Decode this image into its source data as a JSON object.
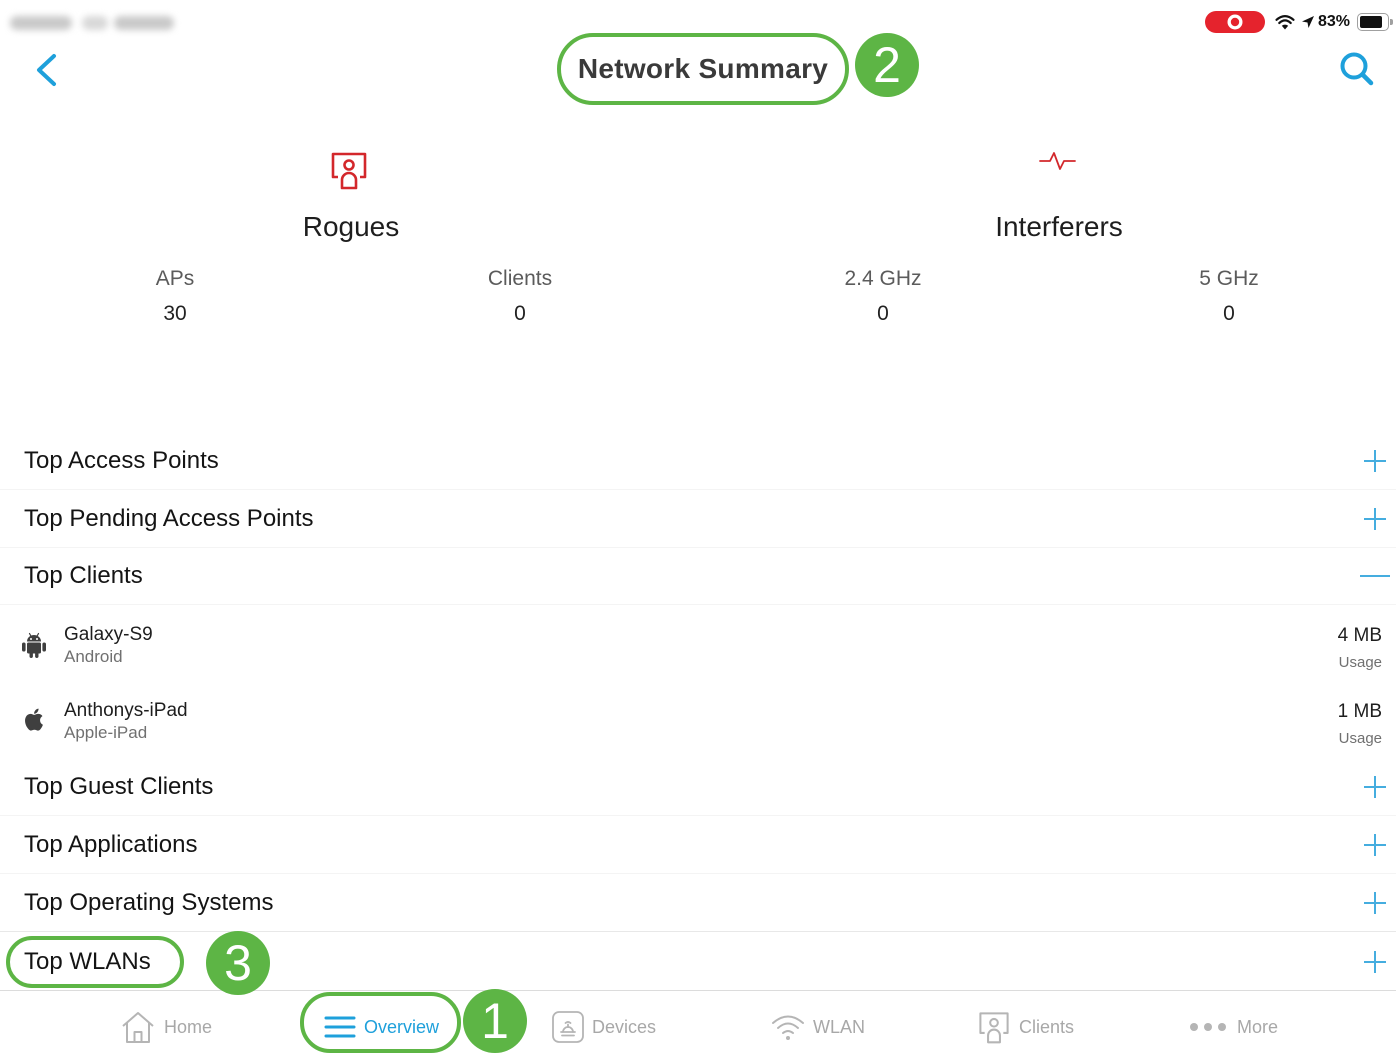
{
  "status_bar": {
    "recording_indicator_icon": "screen-recording-icon",
    "wifi_icon": "wifi-signal-icon",
    "location_icon": "location-arrow-icon",
    "battery_icon": "battery-icon",
    "battery_text": "83%",
    "battery_level": 83
  },
  "header": {
    "back_icon": "chevron-left-icon",
    "title": "Network Summary",
    "search_icon": "search-icon"
  },
  "summary": {
    "rogues": {
      "icon": "rogue-icon",
      "title": "Rogues",
      "stats": [
        {
          "label": "APs",
          "value": 30
        },
        {
          "label": "Clients",
          "value": 0
        }
      ]
    },
    "interferers": {
      "icon": "pulse-icon",
      "title": "Interferers",
      "stats": [
        {
          "label": "2.4 GHz",
          "value": 0
        },
        {
          "label": "5 GHz",
          "value": 0
        }
      ]
    }
  },
  "sections": [
    {
      "label": "Top Access Points",
      "expanded": false,
      "toggle_icon": "plus-icon"
    },
    {
      "label": "Top Pending Access Points",
      "expanded": false,
      "toggle_icon": "plus-icon"
    },
    {
      "label": "Top Clients",
      "expanded": true,
      "toggle_icon": "minus-icon",
      "items": [
        {
          "icon": "android-icon",
          "name": "Galaxy-S9",
          "type": "Android",
          "usage": "4 MB",
          "usage_label": "Usage"
        },
        {
          "icon": "apple-icon",
          "name": "Anthonys-iPad",
          "type": "Apple-iPad",
          "usage": "1 MB",
          "usage_label": "Usage"
        }
      ]
    },
    {
      "label": "Top Guest Clients",
      "expanded": false,
      "toggle_icon": "plus-icon"
    },
    {
      "label": "Top Applications",
      "expanded": false,
      "toggle_icon": "plus-icon"
    },
    {
      "label": "Top Operating Systems",
      "expanded": false,
      "toggle_icon": "plus-icon"
    },
    {
      "label": "Top WLANs",
      "expanded": false,
      "toggle_icon": "plus-icon"
    }
  ],
  "tab_bar": {
    "tabs": [
      {
        "label": "Home",
        "icon": "home-icon",
        "active": false
      },
      {
        "label": "Overview",
        "icon": "menu-icon",
        "active": true
      },
      {
        "label": "Devices",
        "icon": "devices-icon",
        "active": false
      },
      {
        "label": "WLAN",
        "icon": "wifi-icon",
        "active": false
      },
      {
        "label": "Clients",
        "icon": "clients-icon",
        "active": false
      },
      {
        "label": "More",
        "icon": "more-dots-icon",
        "active": false
      }
    ]
  },
  "callouts": {
    "overview_tab": "1",
    "page_title": "2",
    "top_wlans": "3"
  },
  "colors": {
    "accent": "#1EA0DB",
    "accent_light": "#45ADDF",
    "alert": "#D3272B",
    "callout": "#5DB545",
    "tab_inactive": "#A8A8A8"
  }
}
